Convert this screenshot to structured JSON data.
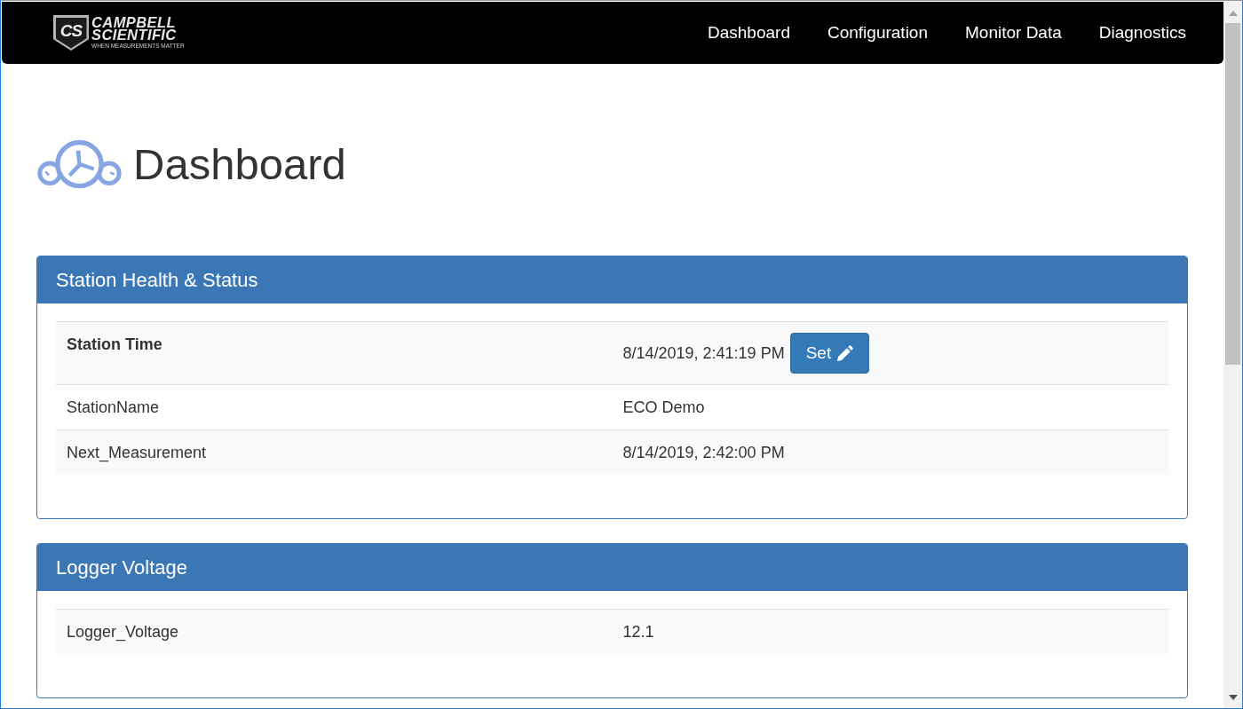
{
  "navbar": {
    "brand": {
      "monogram": "CS",
      "name_lines": [
        "CAMPBELL",
        "SCIENTIFIC"
      ],
      "tagline": "WHEN MEASUREMENTS MATTER"
    },
    "links": [
      "Dashboard",
      "Configuration",
      "Monitor Data",
      "Diagnostics"
    ]
  },
  "page": {
    "title": "Dashboard"
  },
  "panels": [
    {
      "title": "Station Health & Status",
      "rows": [
        {
          "kind": "setting",
          "label": "Station Time",
          "value": "8/14/2019, 2:41:19 PM",
          "action": "Set"
        },
        {
          "kind": "reading",
          "label": "StationName",
          "value": "ECO Demo"
        },
        {
          "kind": "reading",
          "label": "Next_Measurement",
          "value": "8/14/2019, 2:42:00 PM"
        }
      ]
    },
    {
      "title": "Logger Voltage",
      "rows": [
        {
          "kind": "reading",
          "label": "Logger_Voltage",
          "value": "12.1"
        }
      ]
    }
  ]
}
